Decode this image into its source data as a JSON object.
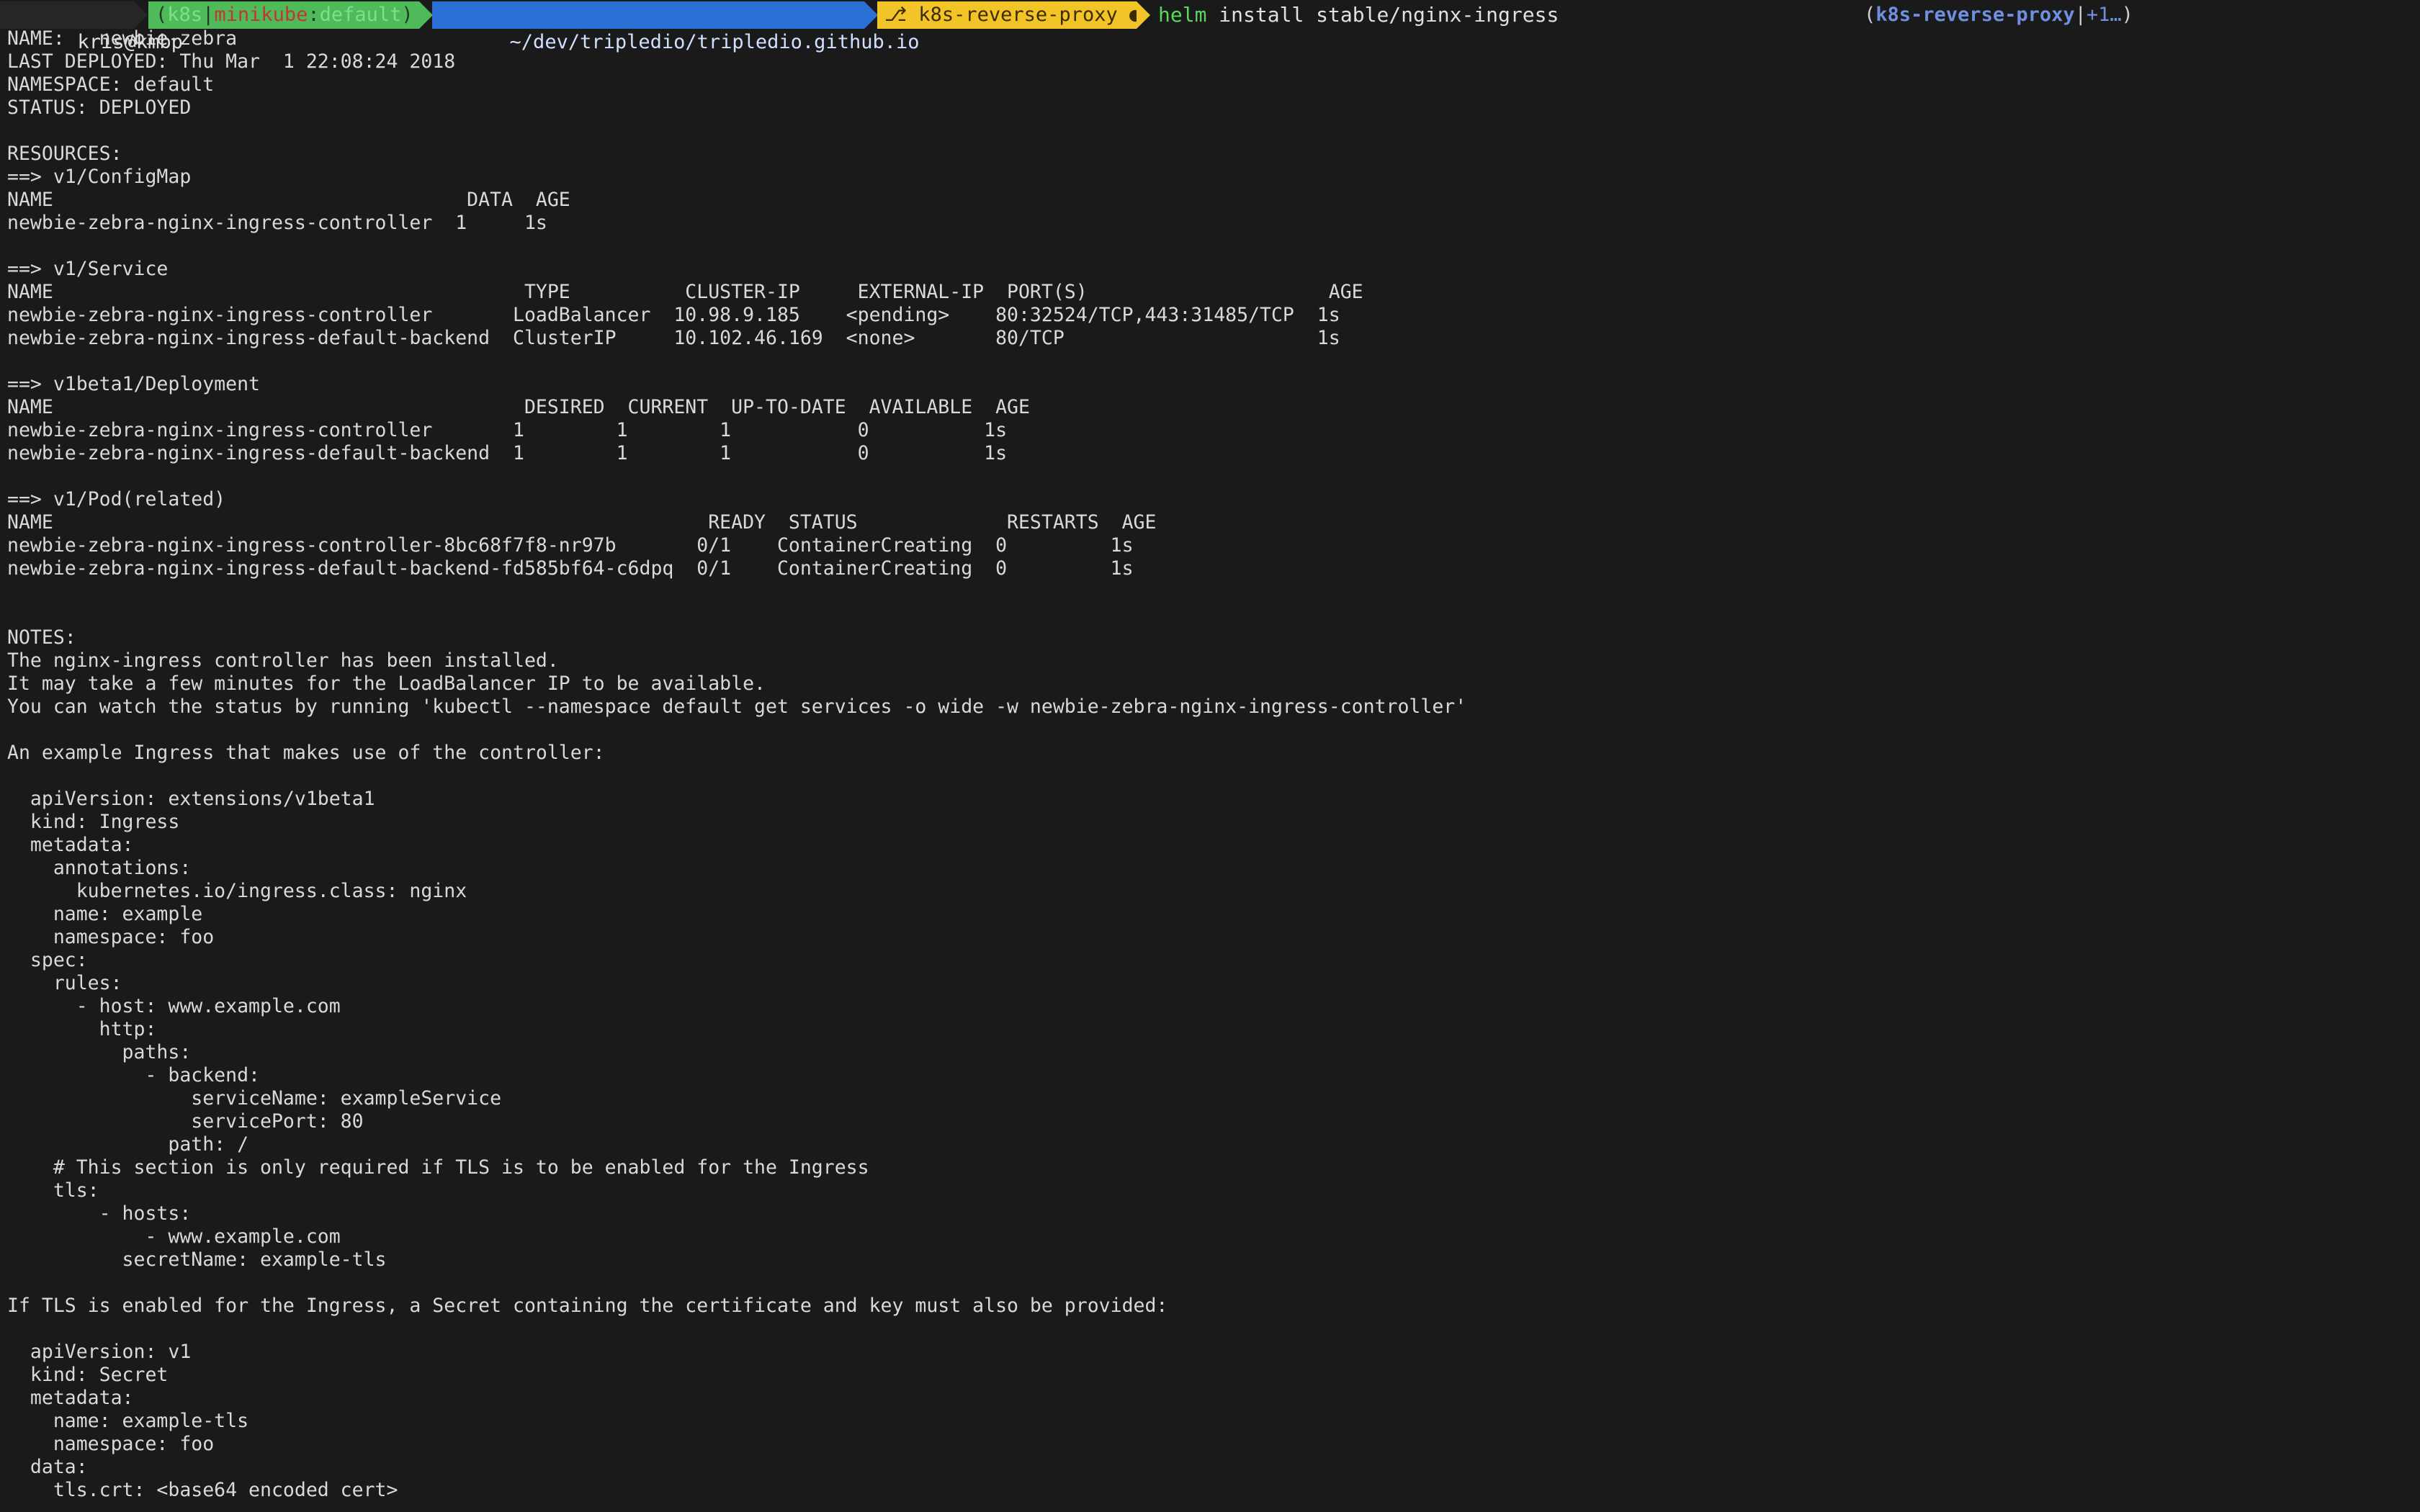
{
  "prompt": {
    "user_host": "kris@kmbp",
    "k8s_label": "k8s",
    "context_cluster": "minikube",
    "context_namespace": "default",
    "path": "~/dev/tripledio/tripledio.github.io",
    "git_branch": "k8s-reverse-proxy",
    "git_dirty_marker": "●",
    "command_name": "helm",
    "command_args": " install stable/nginx-ingress",
    "right_branch": "k8s-reverse-proxy",
    "right_ahead": "+1…"
  },
  "output_lines": [
    "NAME:   newbie-zebra",
    "LAST DEPLOYED: Thu Mar  1 22:08:24 2018",
    "NAMESPACE: default",
    "STATUS: DEPLOYED",
    "",
    "RESOURCES:",
    "==> v1/ConfigMap",
    "NAME                                    DATA  AGE",
    "newbie-zebra-nginx-ingress-controller  1     1s",
    "",
    "==> v1/Service",
    "NAME                                         TYPE          CLUSTER-IP     EXTERNAL-IP  PORT(S)                     AGE",
    "newbie-zebra-nginx-ingress-controller       LoadBalancer  10.98.9.185    <pending>    80:32524/TCP,443:31485/TCP  1s",
    "newbie-zebra-nginx-ingress-default-backend  ClusterIP     10.102.46.169  <none>       80/TCP                      1s",
    "",
    "==> v1beta1/Deployment",
    "NAME                                         DESIRED  CURRENT  UP-TO-DATE  AVAILABLE  AGE",
    "newbie-zebra-nginx-ingress-controller       1        1        1           0          1s",
    "newbie-zebra-nginx-ingress-default-backend  1        1        1           0          1s",
    "",
    "==> v1/Pod(related)",
    "NAME                                                         READY  STATUS             RESTARTS  AGE",
    "newbie-zebra-nginx-ingress-controller-8bc68f7f8-nr97b       0/1    ContainerCreating  0         1s",
    "newbie-zebra-nginx-ingress-default-backend-fd585bf64-c6dpq  0/1    ContainerCreating  0         1s",
    "",
    "",
    "NOTES:",
    "The nginx-ingress controller has been installed.",
    "It may take a few minutes for the LoadBalancer IP to be available.",
    "You can watch the status by running 'kubectl --namespace default get services -o wide -w newbie-zebra-nginx-ingress-controller'",
    "",
    "An example Ingress that makes use of the controller:",
    "",
    "  apiVersion: extensions/v1beta1",
    "  kind: Ingress",
    "  metadata:",
    "    annotations:",
    "      kubernetes.io/ingress.class: nginx",
    "    name: example",
    "    namespace: foo",
    "  spec:",
    "    rules:",
    "      - host: www.example.com",
    "        http:",
    "          paths:",
    "            - backend:",
    "                serviceName: exampleService",
    "                servicePort: 80",
    "              path: /",
    "    # This section is only required if TLS is to be enabled for the Ingress",
    "    tls:",
    "        - hosts:",
    "            - www.example.com",
    "          secretName: example-tls",
    "",
    "If TLS is enabled for the Ingress, a Secret containing the certificate and key must also be provided:",
    "",
    "  apiVersion: v1",
    "  kind: Secret",
    "  metadata:",
    "    name: example-tls",
    "    namespace: foo",
    "  data:",
    "    tls.crt: <base64 encoded cert>"
  ]
}
